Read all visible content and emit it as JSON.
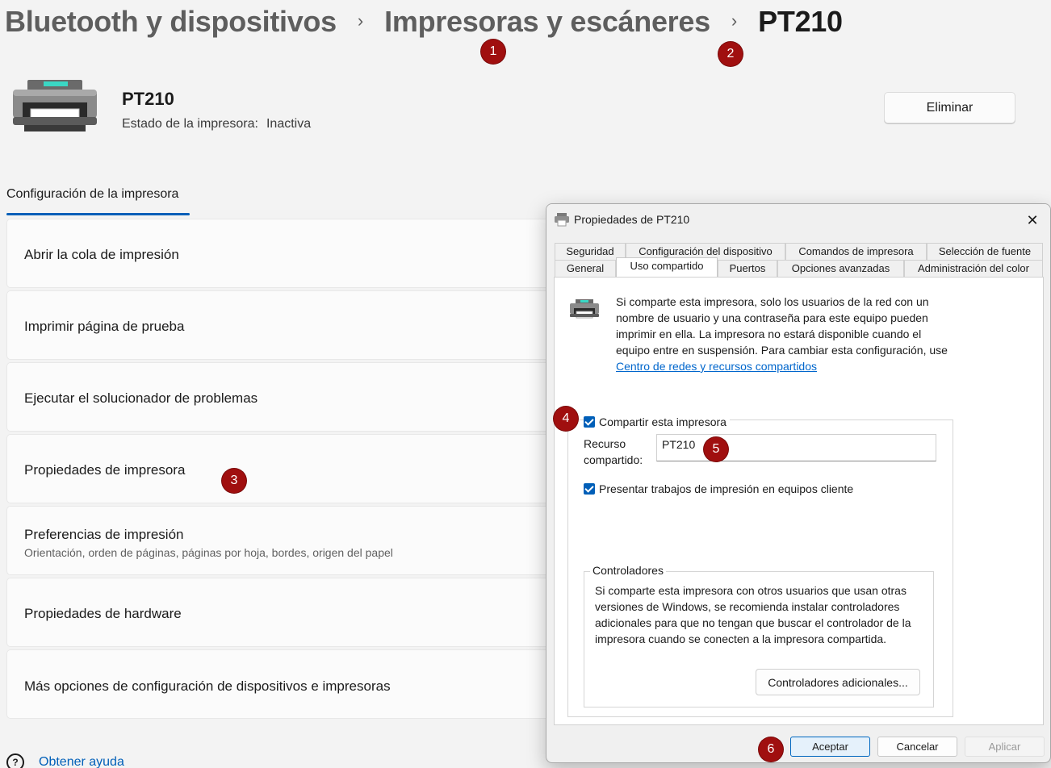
{
  "breadcrumb": {
    "item1": "Bluetooth y dispositivos",
    "item2": "Impresoras y escáneres",
    "item3": "PT210",
    "separator": "›"
  },
  "markers": {
    "m1": "1",
    "m2": "2",
    "m3": "3",
    "m4": "4",
    "m5": "5",
    "m6": "6"
  },
  "device": {
    "icon": "printer-icon",
    "name": "PT210",
    "status_label": "Estado de la impresora:",
    "status_value": "Inactiva",
    "remove_button": "Eliminar"
  },
  "section": {
    "tab_label": "Configuración de la impresora"
  },
  "settings": [
    {
      "label": "Abrir la cola de impresión"
    },
    {
      "label": "Imprimir página de prueba"
    },
    {
      "label": "Ejecutar el solucionador de problemas"
    },
    {
      "label": "Propiedades de impresora"
    },
    {
      "label": "Preferencias de impresión",
      "sub": "Orientación, orden de páginas, páginas por hoja, bordes, origen del papel"
    },
    {
      "label": "Propiedades de hardware"
    },
    {
      "label": "Más opciones de configuración de dispositivos e impresoras"
    }
  ],
  "help": {
    "icon": "help-icon",
    "label": "Obtener ayuda"
  },
  "dialog": {
    "title": "Propiedades de PT210",
    "close_glyph": "✕",
    "tabs_row1": [
      "Seguridad",
      "Configuración del dispositivo",
      "Comandos de impresora",
      "Selección de fuente"
    ],
    "tabs_row2": [
      "General",
      "Uso compartido",
      "Puertos",
      "Opciones avanzadas",
      "Administración del color"
    ],
    "active_tab": "Uso compartido",
    "info_text": "Si comparte esta impresora, solo los usuarios de la red con un nombre de usuario y una contraseña para este equipo pueden imprimir en ella. La impresora no estará disponible cuando el equipo entre en suspensión. Para cambiar esta configuración, use ",
    "info_link": "Centro de redes y recursos compartidos",
    "share_checkbox": {
      "label": "Compartir esta impresora",
      "checked": true
    },
    "share_name_label_1": "Recurso",
    "share_name_label_2": "compartido:",
    "share_name_value": "PT210",
    "render_checkbox": {
      "label": "Presentar trabajos de impresión en equipos cliente",
      "checked": true
    },
    "drivers_legend": "Controladores",
    "drivers_text": "Si comparte esta impresora con otros usuarios que usan otras versiones de Windows, se recomienda instalar controladores adicionales para que no tengan que buscar el controlador de la impresora cuando se conecten a la impresora compartida.",
    "drivers_button": "Controladores adicionales...",
    "ok_button": "Aceptar",
    "cancel_button": "Cancelar",
    "apply_button": "Aplicar"
  },
  "colors": {
    "accent": "#005fb8",
    "marker": "#a00f0f",
    "link": "#0066cc"
  }
}
